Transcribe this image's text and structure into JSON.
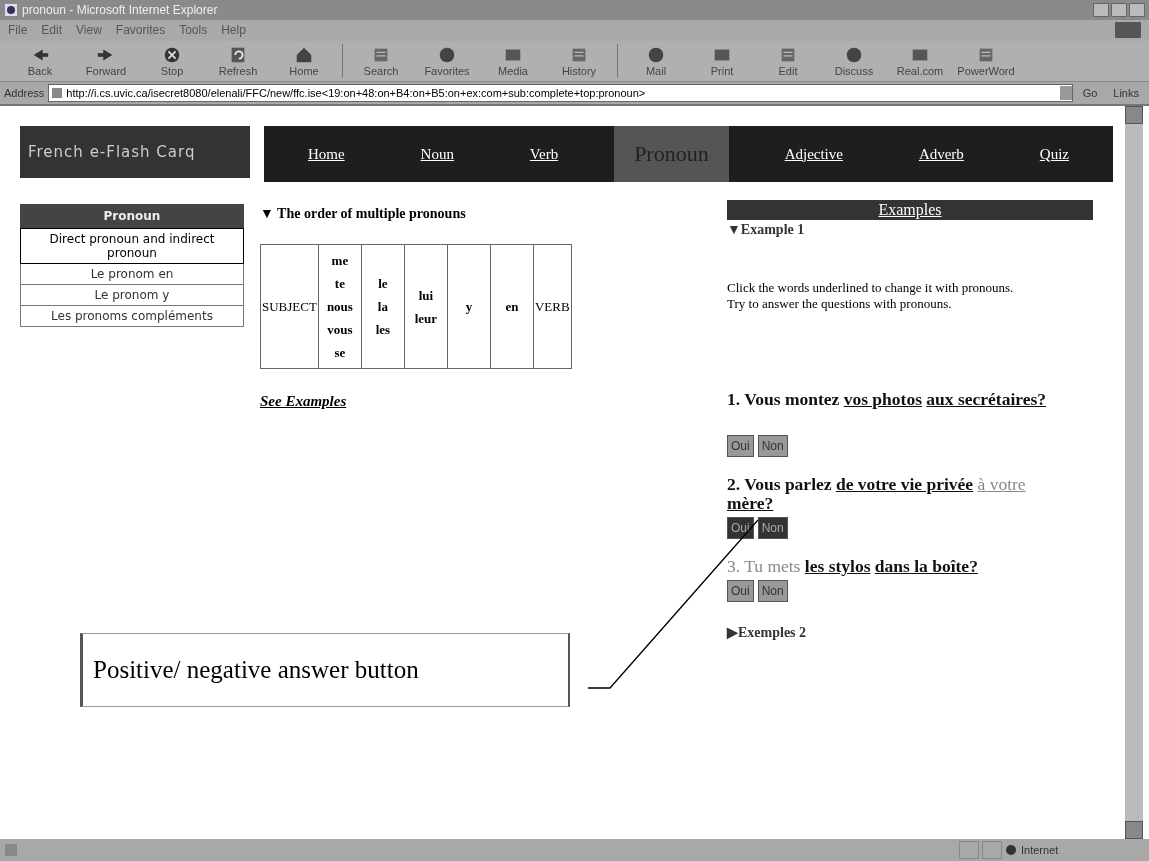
{
  "window": {
    "title": "pronoun - Microsoft Internet Explorer"
  },
  "menu": [
    "File",
    "Edit",
    "View",
    "Favorites",
    "Tools",
    "Help"
  ],
  "toolbar": [
    {
      "label": "Back"
    },
    {
      "label": "Forward"
    },
    {
      "label": "Stop"
    },
    {
      "label": "Refresh"
    },
    {
      "label": "Home"
    },
    {
      "label": "Search"
    },
    {
      "label": "Favorites"
    },
    {
      "label": "Media"
    },
    {
      "label": "History"
    },
    {
      "label": "Mail"
    },
    {
      "label": "Print"
    },
    {
      "label": "Edit"
    },
    {
      "label": "Discuss"
    },
    {
      "label": "Real.com"
    },
    {
      "label": "PowerWord"
    }
  ],
  "address": {
    "label": "Address",
    "value": "http://i.cs.uvic.ca/isecret8080/elenali/FFC/new/ffc.ise<19:on+48:on+B4:on+B5:on+ex:com+sub:complete+top:pronoun>",
    "go": "Go",
    "links": "Links"
  },
  "banner": "French e-Flash Carq",
  "nav": [
    {
      "label": "Home",
      "selected": false
    },
    {
      "label": "Noun",
      "selected": false
    },
    {
      "label": "Verb",
      "selected": false
    },
    {
      "label": "Pronoun",
      "selected": true
    },
    {
      "label": "Adjective",
      "selected": false
    },
    {
      "label": "Adverb",
      "selected": false
    },
    {
      "label": "Quiz",
      "selected": false
    }
  ],
  "sidebar": {
    "title": "Pronoun",
    "items": [
      {
        "label": "Direct pronoun and indirect pronoun",
        "selected": true
      },
      {
        "label": "Le pronom en",
        "selected": false
      },
      {
        "label": "Le pronom y",
        "selected": false
      },
      {
        "label": "Les pronoms compléments",
        "selected": false
      }
    ]
  },
  "section": {
    "heading": "▼ The order of multiple pronouns",
    "table": [
      [
        "SUBJECT"
      ],
      [
        "me",
        "te",
        "nous",
        "vous",
        "se"
      ],
      [
        "le",
        "la",
        "les"
      ],
      [
        "lui",
        "leur"
      ],
      [
        "y"
      ],
      [
        "en"
      ],
      [
        "VERB"
      ]
    ],
    "link": "See Examples"
  },
  "examples": {
    "title": "Examples",
    "example_1": "▼Example 1",
    "instructions": [
      "Click the words underlined to change it with pronouns.",
      "Try to answer the questions with pronouns."
    ],
    "questions": [
      {
        "parts": [
          {
            "text": "1. Vous montez ",
            "kind": "plain"
          },
          {
            "text": "vos photos",
            "kind": "link"
          },
          {
            "text": "aux secrétaires?",
            "kind": "link"
          }
        ],
        "buttons": [
          {
            "label": "Oui",
            "pressed": false
          },
          {
            "label": "Non",
            "pressed": false
          }
        ]
      },
      {
        "parts": [
          {
            "text": "2. Vous parlez ",
            "kind": "plain"
          },
          {
            "text": "de votre vie privée",
            "kind": "link"
          },
          {
            "text": "à votre",
            "kind": "dim-link"
          },
          {
            "text": "mère?",
            "kind": "link"
          }
        ],
        "buttons": [
          {
            "label": "Oui",
            "pressed": true
          },
          {
            "label": "Non",
            "pressed": true
          }
        ]
      },
      {
        "parts": [
          {
            "text": "3. Tu mets ",
            "kind": "dim"
          },
          {
            "text": "les stylos",
            "kind": "link"
          },
          {
            "text": "dans la boîte?",
            "kind": "link"
          }
        ],
        "buttons": [
          {
            "label": "Oui",
            "pressed": false
          },
          {
            "label": "Non",
            "pressed": false
          }
        ]
      }
    ],
    "example_2": "▶Exemples 2"
  },
  "callout": "Positive/ negative answer button",
  "status_bar": {
    "zone": "Internet"
  }
}
